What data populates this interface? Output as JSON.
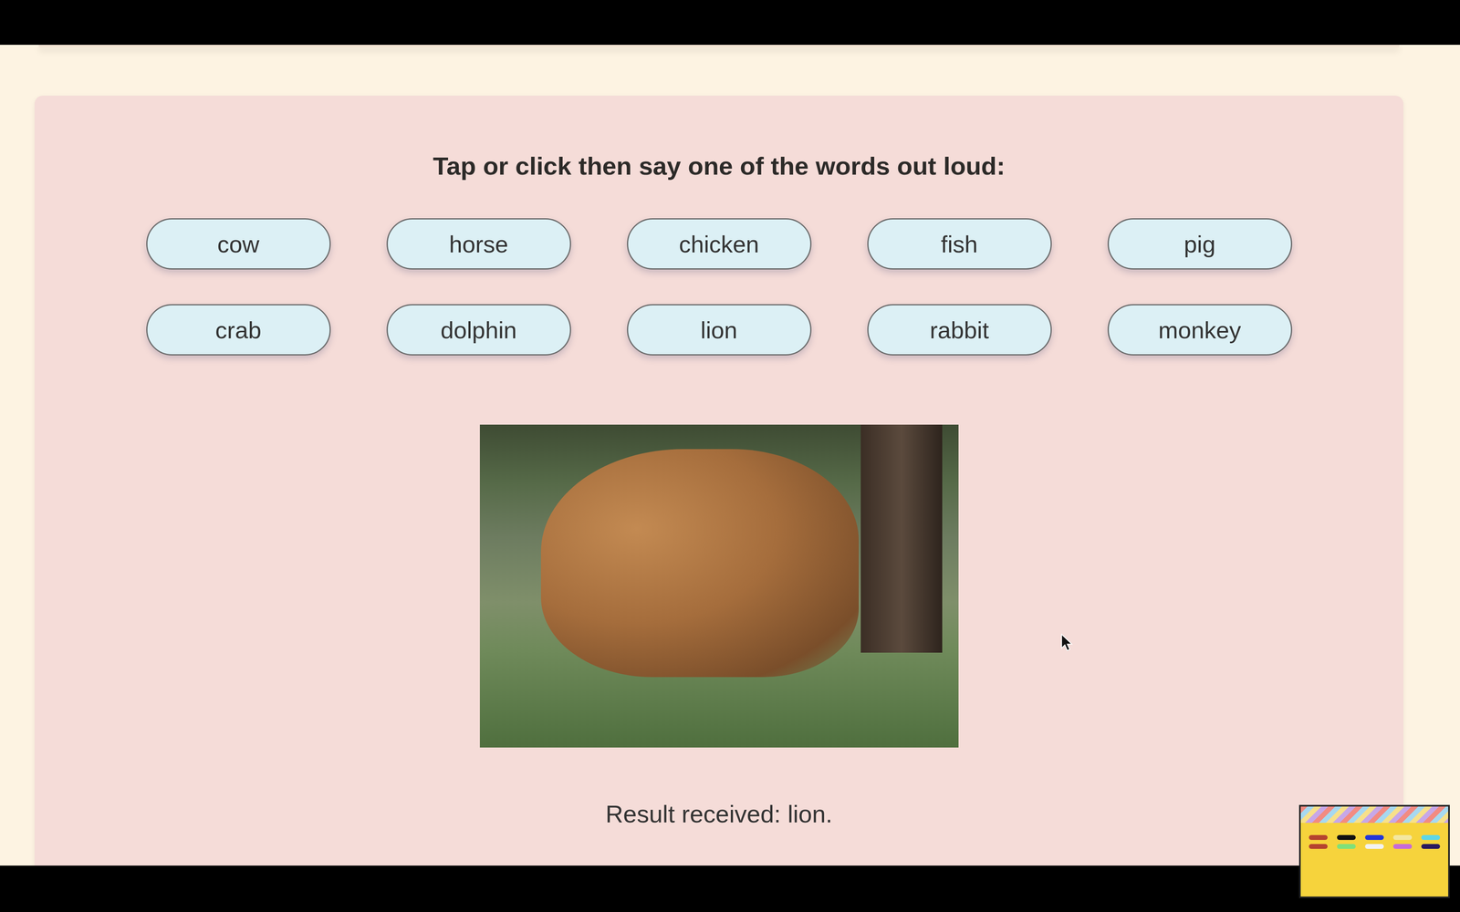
{
  "prompt": {
    "heading": "Tap or click then say one of the words out loud:"
  },
  "words": [
    {
      "label": "cow"
    },
    {
      "label": "horse"
    },
    {
      "label": "chicken"
    },
    {
      "label": "fish"
    },
    {
      "label": "pig"
    },
    {
      "label": "crab"
    },
    {
      "label": "dolphin"
    },
    {
      "label": "lion"
    },
    {
      "label": "rabbit"
    },
    {
      "label": "monkey"
    }
  ],
  "result": {
    "text": "Result received: lion."
  }
}
